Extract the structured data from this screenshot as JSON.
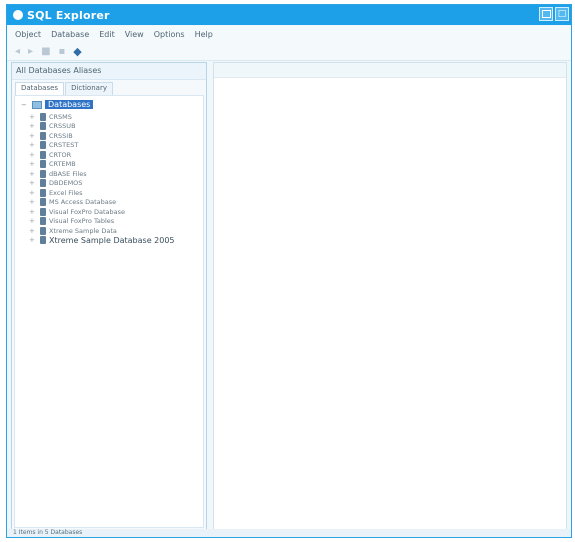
{
  "window": {
    "title": "SQL Explorer"
  },
  "menubar": {
    "items": [
      "Object",
      "Database",
      "Edit",
      "View",
      "Options",
      "Help"
    ]
  },
  "left_pane": {
    "header": "All Databases Aliases",
    "tabs": [
      "Databases",
      "Dictionary"
    ],
    "tree": {
      "root": "Databases",
      "items": [
        "CRSMS",
        "CRSSUB",
        "CRSSIB",
        "CRSTEST",
        "CRTOR",
        "CRTEMB",
        "dBASE Files",
        "DBDEMOS",
        "Excel Files",
        "MS Access Database",
        "Visual FoxPro Database",
        "Visual FoxPro Tables",
        "Xtreme Sample Data",
        "Xtreme Sample Database 2005"
      ]
    }
  },
  "statusbar": {
    "text": "1 Items in 5 Databases"
  }
}
